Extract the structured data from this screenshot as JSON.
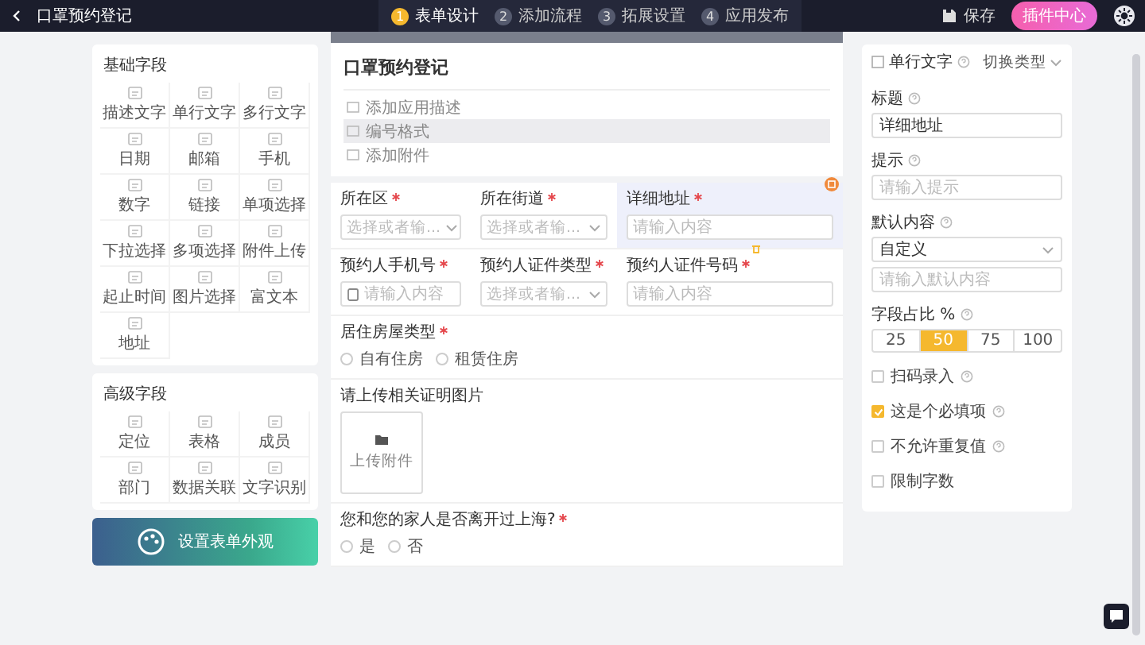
{
  "topbar": {
    "title": "口罩预约登记",
    "steps": [
      {
        "number": "1",
        "label": "表单设计",
        "selected": true
      },
      {
        "number": "2",
        "label": "添加流程",
        "selected": false
      },
      {
        "number": "3",
        "label": "拓展设置",
        "selected": false
      },
      {
        "number": "4",
        "label": "应用发布",
        "selected": false
      }
    ],
    "save": "保存",
    "plugin_button": "插件中心"
  },
  "palette": {
    "groups": [
      {
        "title": "基础字段",
        "items": [
          "描述文字",
          "单行文字",
          "多行文字",
          "日期",
          "邮箱",
          "手机",
          "数字",
          "链接",
          "单项选择",
          "下拉选择",
          "多项选择",
          "附件上传",
          "起止时间",
          "图片选择",
          "富文本",
          "地址"
        ]
      },
      {
        "title": "高级字段",
        "items": [
          "定位",
          "表格",
          "成员",
          "部门",
          "数据关联",
          "文字识别"
        ]
      }
    ],
    "banner": "设置表单外观"
  },
  "form": {
    "title": "口罩预约登记",
    "options": [
      {
        "label": "添加应用描述",
        "selected": false
      },
      {
        "label": "编号格式",
        "selected": true
      },
      {
        "label": "添加附件",
        "selected": false
      }
    ],
    "rows": [
      {
        "fields": [
          {
            "kind": "select",
            "label": "所在区",
            "required": true,
            "placeholder": "选择或者输...",
            "selected": false
          },
          {
            "kind": "select",
            "label": "所在街道",
            "required": true,
            "placeholder": "选择或者输...",
            "selected": false
          },
          {
            "kind": "text",
            "label": "详细地址",
            "required": true,
            "placeholder": "请输入内容",
            "selected": true
          }
        ]
      },
      {
        "fields": [
          {
            "kind": "phone",
            "label": "预约人手机号",
            "required": true,
            "placeholder": "请输入内容",
            "selected": false
          },
          {
            "kind": "select",
            "label": "预约人证件类型",
            "required": true,
            "placeholder": "选择或者输...",
            "selected": false
          },
          {
            "kind": "text",
            "label": "预约人证件号码",
            "required": true,
            "placeholder": "请输入内容",
            "selected": false
          }
        ]
      },
      {
        "fields": [
          {
            "kind": "radio",
            "label": "居住房屋类型",
            "required": true,
            "options": [
              {
                "label": "自有住房",
                "selected": false
              },
              {
                "label": "租赁住房",
                "selected": false
              }
            ],
            "selected": false
          }
        ]
      },
      {
        "fields": [
          {
            "kind": "upload",
            "label": "请上传相关证明图片",
            "required": false,
            "button": "上传附件",
            "selected": false
          }
        ]
      },
      {
        "fields": [
          {
            "kind": "radio",
            "label": "您和您的家人是否离开过上海?",
            "required": true,
            "options": [
              {
                "label": "是",
                "selected": false
              },
              {
                "label": "否",
                "selected": false
              }
            ],
            "selected": false
          }
        ]
      }
    ]
  },
  "inspector": {
    "type_label": "单行文字",
    "switch": "切换类型",
    "title_label": "标题",
    "title_value": "详细地址",
    "hint_label": "提示",
    "hint_placeholder": "请输入提示",
    "default_label": "默认内容",
    "default_select": "自定义",
    "default_placeholder": "请输入默认内容",
    "width_label": "字段占比 %",
    "width_options": [
      {
        "label": "25",
        "selected": false
      },
      {
        "label": "50",
        "selected": true
      },
      {
        "label": "75",
        "selected": false
      },
      {
        "label": "100",
        "selected": false
      }
    ],
    "checks": [
      {
        "label": "扫码录入",
        "checked": false,
        "help": true
      },
      {
        "label": "这是个必填项",
        "checked": true,
        "help": true
      },
      {
        "label": "不允许重复值",
        "checked": false,
        "help": true
      },
      {
        "label": "限制字数",
        "checked": false,
        "help": false
      }
    ]
  }
}
